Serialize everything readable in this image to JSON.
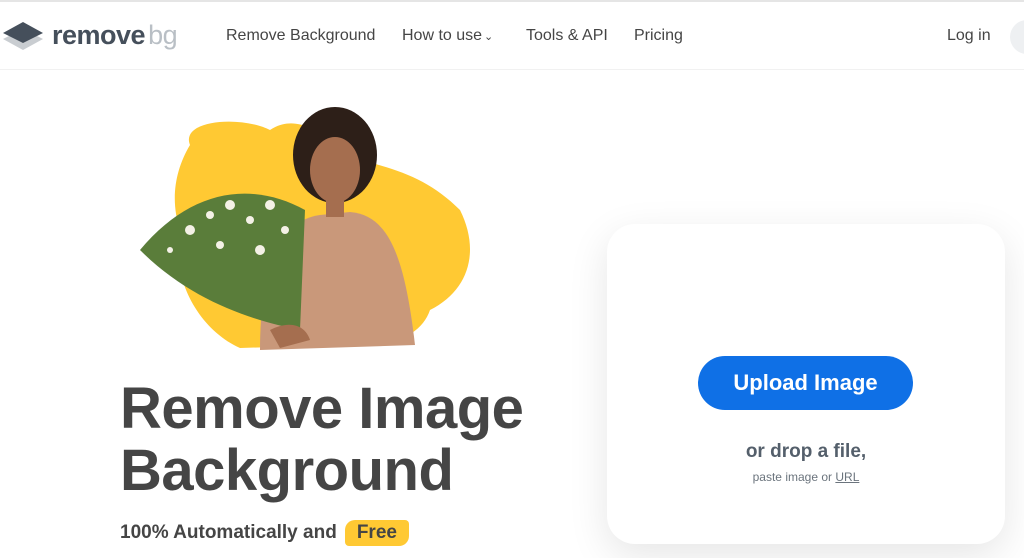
{
  "brand": {
    "name": "remove",
    "suffix": "bg"
  },
  "nav": {
    "items": [
      "Remove Background",
      "How to use",
      "Tools & API",
      "Pricing"
    ],
    "login": "Log in"
  },
  "hero": {
    "title_line1": "Remove Image",
    "title_line2": "Background",
    "subtitle": "100% Automatically and",
    "badge": "Free"
  },
  "upload": {
    "button": "Upload Image",
    "drop": "or drop a file,",
    "paste": "paste image or",
    "url": "URL"
  },
  "colors": {
    "accent": "#0f70e6",
    "yellow": "#ffc933",
    "text": "#454545"
  }
}
